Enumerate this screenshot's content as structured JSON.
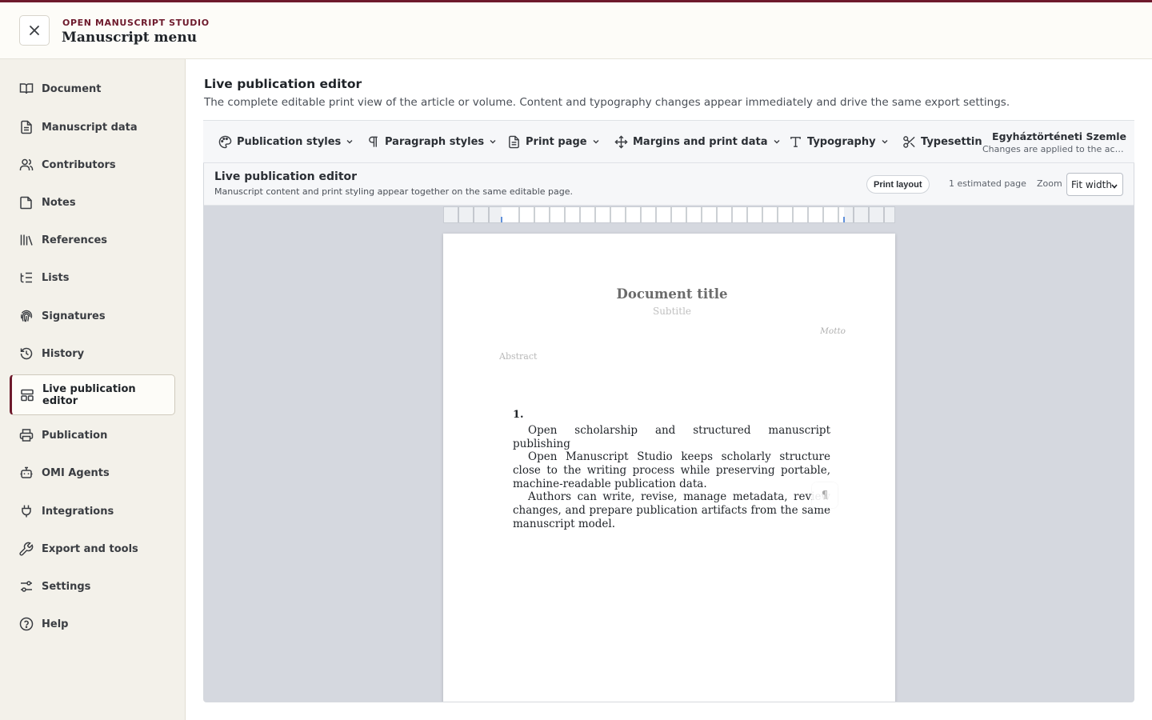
{
  "header": {
    "brand": "OPEN MANUSCRIPT STUDIO",
    "title": "Manuscript menu"
  },
  "sidebar": {
    "items": [
      {
        "label": "Document",
        "icon": "book-open-icon"
      },
      {
        "label": "Manuscript data",
        "icon": "file-text-icon"
      },
      {
        "label": "Contributors",
        "icon": "users-icon"
      },
      {
        "label": "Notes",
        "icon": "note-icon"
      },
      {
        "label": "References",
        "icon": "library-icon"
      },
      {
        "label": "Lists",
        "icon": "list-tree-icon"
      },
      {
        "label": "Signatures",
        "icon": "fingerprint-icon"
      },
      {
        "label": "History",
        "icon": "history-icon"
      },
      {
        "label": "Live publication editor",
        "icon": "layout-template-icon",
        "active": true
      },
      {
        "label": "Publication",
        "icon": "printer-icon"
      },
      {
        "label": "OMI Agents",
        "icon": "bot-icon"
      },
      {
        "label": "Integrations",
        "icon": "plug-icon"
      },
      {
        "label": "Export and tools",
        "icon": "wrench-icon"
      },
      {
        "label": "Settings",
        "icon": "sliders-icon"
      },
      {
        "label": "Help",
        "icon": "help-circle-icon"
      }
    ]
  },
  "main": {
    "title": "Live publication editor",
    "description": "The complete editable print view of the article or volume. Content and typography changes appear immediately and drive the same export settings."
  },
  "toolbar": {
    "items": [
      {
        "label": "Publication styles",
        "icon": "palette-icon"
      },
      {
        "label": "Paragraph styles",
        "icon": "pilcrow-icon"
      },
      {
        "label": "Print page",
        "icon": "file-icon"
      },
      {
        "label": "Margins and print data",
        "icon": "move-icon"
      },
      {
        "label": "Typography",
        "icon": "type-icon"
      },
      {
        "label": "Typesettin",
        "icon": "scissors-icon"
      }
    ],
    "journal_title": "Egyháztörténeti Szemle",
    "journal_note": "Changes are applied to the acti..."
  },
  "editor": {
    "title": "Live publication editor",
    "subtitle": "Manuscript content and print styling appear together on the same editable page.",
    "print_layout_label": "Print layout",
    "estimated_pages": "1 estimated page",
    "zoom_label": "Zoom",
    "zoom_value": "Fit width"
  },
  "page": {
    "doc_title": "Document title",
    "doc_subtitle": "Subtitle",
    "motto": "Motto",
    "abstract": "Abstract",
    "section_number": "1.",
    "paragraphs": [
      "Open scholarship and structured manuscript publishing",
      "Open Manuscript Studio keeps scholarly structure close to the writing process while preserving portable, machine-readable publication data.",
      "Authors can write, revise, manage metadata, review changes, and prepare publication artifacts from the same manuscript model."
    ],
    "pilcrow": "¶"
  },
  "colors": {
    "accent": "#6e1a2c",
    "sidebar_bg": "#f3f1ea",
    "canvas_bg": "#d5d8df"
  }
}
